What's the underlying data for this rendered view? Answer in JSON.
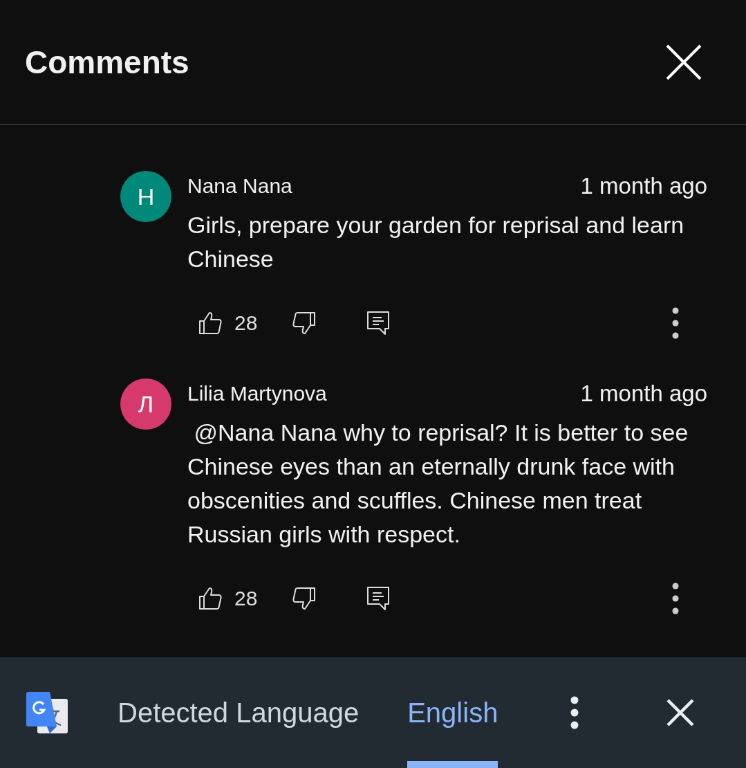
{
  "header": {
    "title": "Comments"
  },
  "comments": [
    {
      "avatar_letter": "H",
      "color": "#00897b",
      "author": "Nana Nana",
      "time": "1 month ago",
      "text": "Girls, prepare your garden for reprisal and learn Chinese",
      "likes": "28"
    },
    {
      "avatar_letter": "Л",
      "color": "#d63a6c",
      "author": "Lilia Martynova",
      "time": "1 month ago",
      "text": " @Nana Nana why to reprisal? It is better to see Chinese eyes than an eternally drunk face with obscenities and scuffles. Chinese men treat Russian girls with respect.",
      "likes": "28"
    }
  ],
  "translate_bar": {
    "tabs": [
      {
        "label": "Detected Language",
        "selected": false
      },
      {
        "label": "English",
        "selected": true
      }
    ]
  }
}
